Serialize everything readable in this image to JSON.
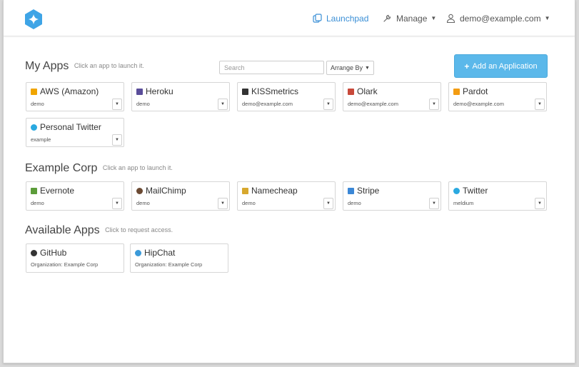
{
  "header": {
    "launchpad": "Launchpad",
    "manage": "Manage",
    "account": "demo@example.com",
    "brand_color": "#3a8fd6"
  },
  "my_apps": {
    "title": "My Apps",
    "hint": "Click an app to launch it.",
    "search_placeholder": "Search",
    "arrange_label": "Arrange By",
    "add_label": "Add an Application",
    "apps": [
      {
        "name": "AWS (Amazon)",
        "user": "demo",
        "icon": "aws-icon",
        "color": "#f0a500"
      },
      {
        "name": "Heroku",
        "user": "demo",
        "icon": "heroku-icon",
        "color": "#5a4d9a"
      },
      {
        "name": "KISSmetrics",
        "user": "demo@example.com",
        "icon": "kissmetrics-icon",
        "color": "#333333"
      },
      {
        "name": "Olark",
        "user": "demo@example.com",
        "icon": "olark-icon",
        "color": "#c8493a"
      },
      {
        "name": "Pardot",
        "user": "demo@example.com",
        "icon": "pardot-icon",
        "color": "#f39c12"
      },
      {
        "name": "Personal Twitter",
        "user": "example",
        "icon": "twitter-icon",
        "color": "#2aa9e0"
      }
    ]
  },
  "example_corp": {
    "title": "Example Corp",
    "hint": "Click an app to launch it.",
    "apps": [
      {
        "name": "Evernote",
        "user": "demo",
        "icon": "evernote-icon",
        "color": "#5c9c3a"
      },
      {
        "name": "MailChimp",
        "user": "demo",
        "icon": "mailchimp-icon",
        "color": "#6b4a33"
      },
      {
        "name": "Namecheap",
        "user": "demo",
        "icon": "namecheap-icon",
        "color": "#d7a82e"
      },
      {
        "name": "Stripe",
        "user": "demo",
        "icon": "stripe-icon",
        "color": "#3b87d6"
      },
      {
        "name": "Twitter",
        "user": "meldium",
        "icon": "twitter-icon",
        "color": "#2aa9e0"
      }
    ]
  },
  "available_apps": {
    "title": "Available Apps",
    "hint": "Click to request access.",
    "apps": [
      {
        "name": "GitHub",
        "org": "Organization: Example Corp",
        "icon": "github-icon",
        "color": "#333333"
      },
      {
        "name": "HipChat",
        "org": "Organization: Example Corp",
        "icon": "hipchat-icon",
        "color": "#3b9ad9"
      }
    ]
  }
}
